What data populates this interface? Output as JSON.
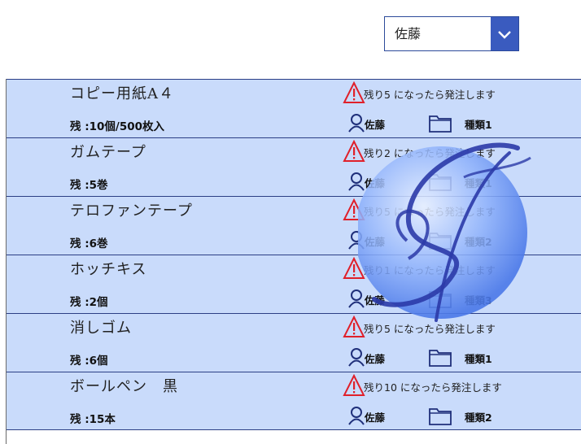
{
  "filter": {
    "selected": "佐藤"
  },
  "items": [
    {
      "name": "コピー用紙A４",
      "stock": "残 :10個/500枚入",
      "alert": "残り5 になったら発注します",
      "owner": "佐藤",
      "category": "種類1"
    },
    {
      "name": "ガムテープ",
      "stock": "残 :5巻",
      "alert": "残り2 になったら発注します",
      "owner": "佐藤",
      "category": "種類1"
    },
    {
      "name": "テロファンテープ",
      "stock": "残 :6巻",
      "alert": "残り5 になったら発注します",
      "owner": "佐藤",
      "category": "種類2"
    },
    {
      "name": "ホッチキス",
      "stock": "残 :2個",
      "alert": "残り1 になったら発注します",
      "owner": "佐藤",
      "category": "種類3"
    },
    {
      "name": "消しゴム",
      "stock": "残 :6個",
      "alert": "残り5 になったら発注します",
      "owner": "佐藤",
      "category": "種類1"
    },
    {
      "name": "ボールペン　黒",
      "stock": "残 :15本",
      "alert": "残り10 になったら発注します",
      "owner": "佐藤",
      "category": "種類2"
    }
  ],
  "icons": {
    "alert": "warning-triangle-icon",
    "owner": "person-icon",
    "category": "folder-icon",
    "dropdown": "chevron-down-icon"
  },
  "colors": {
    "row_background": "#c9dbfb",
    "row_border": "#2b3f85",
    "alert_red": "#e0202a",
    "icon_navy": "#1f2f7a",
    "dropdown_accent": "#3a5bbf"
  }
}
